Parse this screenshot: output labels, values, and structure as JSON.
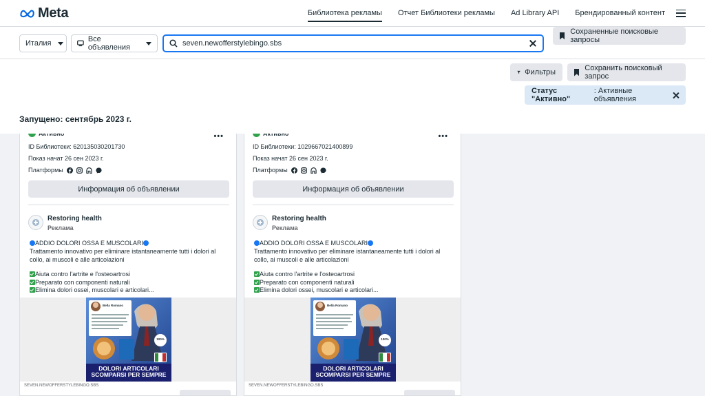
{
  "brand": {
    "logo_text": "Meta",
    "accent": "#1877f2"
  },
  "nav": {
    "links": [
      {
        "label": "Библиотека рекламы",
        "active": true
      },
      {
        "label": "Отчет Библиотеки рекламы"
      },
      {
        "label": "Ad Library API"
      },
      {
        "label": "Брендированный контент"
      }
    ]
  },
  "search": {
    "country": "Италия",
    "ad_category": "Все объявления",
    "query": "seven.newofferstylebingo.sbs",
    "saved_searches_label": "Сохраненные поисковые запросы"
  },
  "filters": {
    "filters_button": "Фильтры",
    "save_search_button": "Сохранить поисковый запрос",
    "chip_key": "Статус \"Активно\"",
    "chip_value": ": Активные объявления"
  },
  "section": {
    "launched_heading": "Запущено: сентябрь 2023 г."
  },
  "cards": [
    {
      "status": "Активно",
      "library_id": "ID Библиотеки: 620135030201730",
      "started": "Показ начат 26 сен 2023 г.",
      "platforms_label": "Платформы",
      "info_button": "Информация об объявлении",
      "advertiser": "Restoring health",
      "sponsored": "Реклама",
      "headline": "ADDIO DOLORI OSSA E MUSCOLARI",
      "body": "Trattamento innovativo per eliminare istantaneamente tutti i dolori al collo, ai muscoli e alle articolazioni",
      "bullets": [
        "Aiuta contro l'artrite e l'osteoartrosi",
        "Preparato con componenti naturali",
        "Elimina dolori ossei, muscolari e articolari..."
      ],
      "creative_caption_1": "DOLORI ARTICOLARI",
      "creative_caption_2": "SCOMPARSI PER SEMPRE",
      "creative_badge": "100%",
      "creative_name": "Bella Romano",
      "domain": "SEVEN.NEWOFFERSTYLEBINGO.SBS"
    },
    {
      "status": "Активно",
      "library_id": "ID Библиотеки: 1029667021400899",
      "started": "Показ начат 26 сен 2023 г.",
      "platforms_label": "Платформы",
      "info_button": "Информация об объявлении",
      "advertiser": "Restoring health",
      "sponsored": "Реклама",
      "headline": "ADDIO DOLORI OSSA E MUSCOLARI",
      "body": "Trattamento innovativo per eliminare istantaneamente tutti i dolori al collo, ai muscoli e alle articolazioni",
      "bullets": [
        "Aiuta contro l'artrite e l'osteoartrosi",
        "Preparato con componenti naturali",
        "Elimina dolori ossei, muscolari e articolari..."
      ],
      "creative_caption_1": "DOLORI ARTICOLARI",
      "creative_caption_2": "SCOMPARSI PER SEMPRE",
      "creative_badge": "100%",
      "creative_name": "Bella Romano",
      "domain": "SEVEN.NEWOFFERSTYLEBINGO.SBS"
    }
  ]
}
